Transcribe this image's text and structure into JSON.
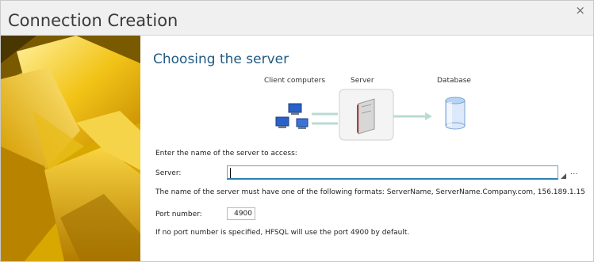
{
  "window": {
    "title": "Connection Creation",
    "close_glyph": "×"
  },
  "page": {
    "heading": "Choosing the server"
  },
  "diagram": {
    "client_label": "Client computers",
    "server_label": "Server",
    "database_label": "Database",
    "icons": [
      "client-computers-icon",
      "server-icon",
      "database-icon"
    ]
  },
  "form": {
    "prompt": "Enter the name of the server to access:",
    "server_label": "Server:",
    "server_value": "",
    "browse_label": "...",
    "format_note": "The name of the server must have one of the following formats: ServerName, ServerName.Company.com, 156.189.1.15",
    "port_label": "Port number:",
    "port_value": "4900",
    "port_note": "If no port number is specified, HFSQL will use the port 4900 by default."
  },
  "colors": {
    "heading": "#1f5a83",
    "input_focus_border": "#2f7fb6",
    "sidebar_gold": "#e8b80a"
  }
}
